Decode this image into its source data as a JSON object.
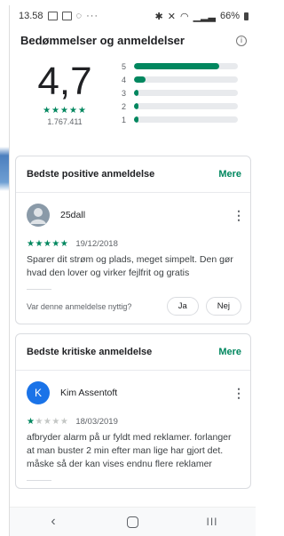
{
  "statusbar": {
    "time": "13.58",
    "dots": "···",
    "battery": "66%"
  },
  "header": {
    "title": "Bedømmelser og anmeldelser"
  },
  "summary": {
    "score": "4,7",
    "stars": "★★★★★",
    "total": "1.767.411",
    "distribution": [
      {
        "label": "5",
        "fraction": 0.82
      },
      {
        "label": "4",
        "fraction": 0.11
      },
      {
        "label": "3",
        "fraction": 0.03
      },
      {
        "label": "2",
        "fraction": 0.02
      },
      {
        "label": "1",
        "fraction": 0.04
      }
    ]
  },
  "positive": {
    "title": "Bedste positive anmeldelse",
    "more": "Mere",
    "name": "25dall",
    "stars_filled": "★★★★★",
    "stars_empty": "",
    "date": "19/12/2018",
    "text": "Sparer dit strøm og plads, meget simpelt. Den gør hvad den lover og virker fejlfrit og gratis",
    "helpful_q": "Var denne anmeldelse nyttig?",
    "yes": "Ja",
    "no": "Nej"
  },
  "critical": {
    "title": "Bedste kritiske anmeldelse",
    "more": "Mere",
    "initial": "K",
    "name": "Kim Assentoft",
    "stars_filled": "★",
    "stars_empty": "★★★★",
    "date": "18/03/2019",
    "text": "afbryder alarm på ur fyldt med reklamer. forlanger at man buster 2 min efter man lige har gjort det. måske så der kan vises endnu flere reklamer"
  },
  "navbar": {
    "back": "‹",
    "recents": "III"
  },
  "colors": {
    "accent": "#01875f",
    "avatar_blue": "#1a73e8"
  }
}
